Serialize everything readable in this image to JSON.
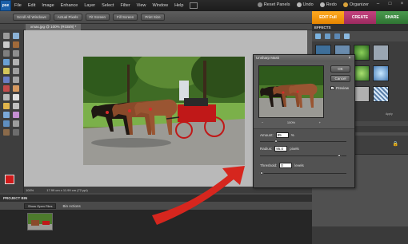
{
  "app": {
    "logo": "pse"
  },
  "menu": {
    "items": [
      "File",
      "Edit",
      "Image",
      "Enhance",
      "Layer",
      "Select",
      "Filter",
      "View",
      "Window",
      "Help"
    ]
  },
  "top_right": {
    "reset_panels": "Reset Panels",
    "undo": "Undo",
    "redo": "Redo",
    "organizer": "Organizer"
  },
  "options_bar": {
    "buttons": [
      "Scroll All Windows",
      "Actual Pixels",
      "Fit Screen",
      "Fill Screen",
      "Print Size"
    ]
  },
  "mode_tabs": {
    "edit": "EDIT Full",
    "create": "CREATE",
    "share": "SHARE"
  },
  "document": {
    "tab_label": "xmas.jpg @ 100% (RGB/8) *",
    "zoom": "100%",
    "size_info": "17.99 cm x 11.99 cm (72 ppi)"
  },
  "project_bin": {
    "title": "PROJECT BIN",
    "show_select": "Show Open Files",
    "bin_actions": "Bin Actions"
  },
  "effects": {
    "title": "EFFECTS",
    "apply_label": "Apply"
  },
  "layers": {
    "opacity_label": "Opacity: 100%"
  },
  "dialog": {
    "title": "Unsharp Mask",
    "ok": "OK",
    "cancel": "Cancel",
    "preview_label": "Preview",
    "preview_checked": true,
    "zoom_level": "100%",
    "amount_label": "Amount:",
    "amount_value": "85",
    "amount_unit": "%",
    "radius_label": "Radius:",
    "radius_value": "95.0",
    "radius_unit": "pixels",
    "threshold_label": "Threshold:",
    "threshold_value": "0",
    "threshold_unit": "levels",
    "amount_slider_fraction": 0.17,
    "radius_slider_fraction": 0.93,
    "threshold_slider_fraction": 0.0
  },
  "colors": {
    "foreground": "#d01a1a",
    "background": "#111111",
    "edit_tab": "#f39a14",
    "create_tab": "#b03a72",
    "share_tab": "#3e8a42",
    "annotation_arrow": "#d6261e"
  }
}
